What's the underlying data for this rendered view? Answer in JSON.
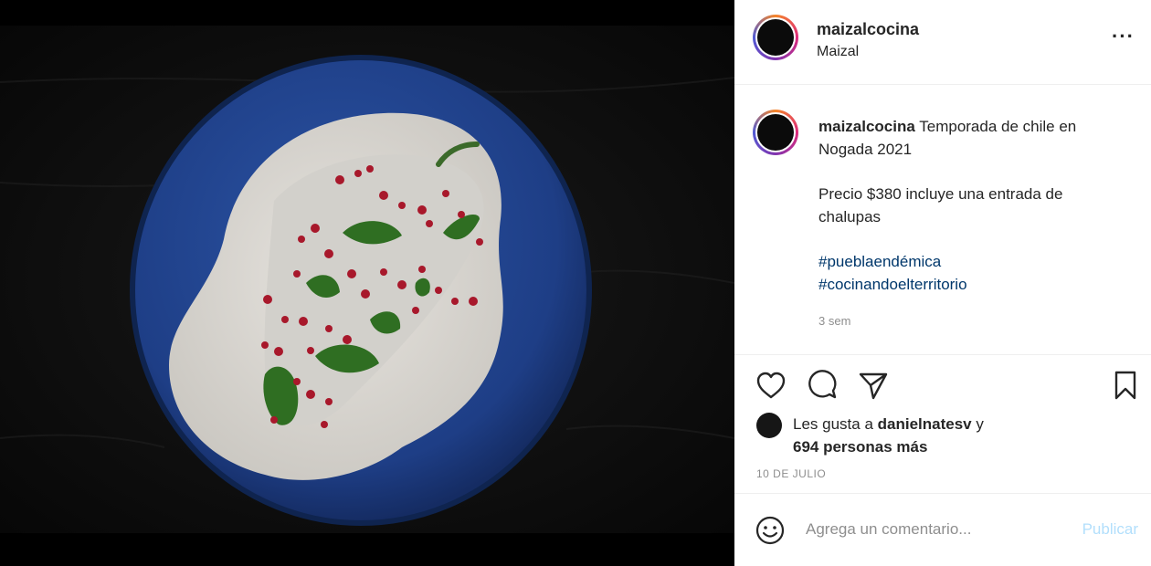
{
  "post": {
    "username": "maizalcocina",
    "location": "Maizal",
    "caption_line1": "Temporada de chile en Nogada 2021",
    "caption_line2": "Precio $380 incluye una entrada de chalupas",
    "hashtags": [
      "#pueblaendémica",
      "#cocinandoelterritorio"
    ],
    "time_ago": "3 sem",
    "likes_prefix": "Les gusta a",
    "likes_user": "danielnatesv",
    "likes_connector": "y",
    "likes_others": "694 personas más",
    "date": "10 DE JULIO"
  },
  "comment": {
    "placeholder": "Agrega un comentario...",
    "publish_label": "Publicar"
  },
  "icons": {
    "more": "more-options-icon",
    "like": "heart-icon",
    "comment": "comment-icon",
    "share": "share-icon",
    "save": "bookmark-icon",
    "emoji": "emoji-icon"
  },
  "colors": {
    "hashtag": "#00376b",
    "publish_disabled": "#b2dffc",
    "plate_blue": "#1f3f86",
    "sauce": "#dad7d1",
    "pomegranate": "#a8182b",
    "parsley": "#2f6e22"
  }
}
